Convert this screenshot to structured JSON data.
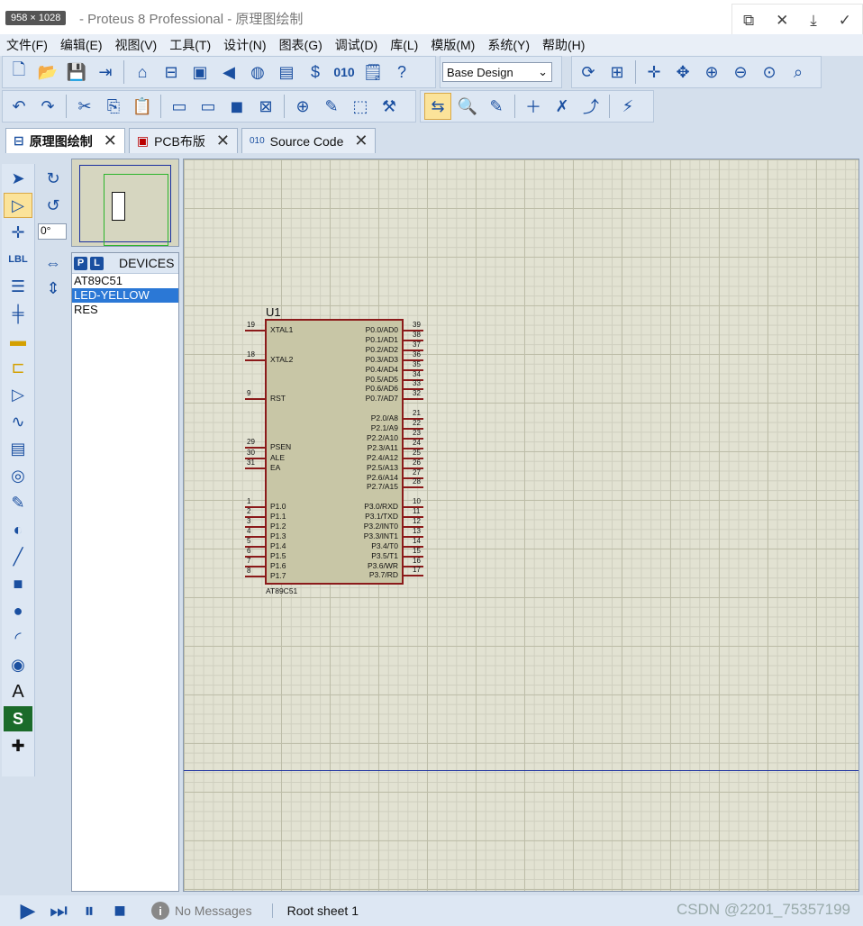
{
  "titlebar": {
    "size_badge": "958 × 1028",
    "title": "- Proteus 8 Professional - 原理图绘制"
  },
  "window_controls": [
    "open-external-icon",
    "close-icon",
    "download-icon",
    "check-icon"
  ],
  "menu": [
    "文件(F)",
    "编辑(E)",
    "视图(V)",
    "工具(T)",
    "设计(N)",
    "图表(G)",
    "调试(D)",
    "库(L)",
    "模版(M)",
    "系统(Y)",
    "帮助(H)"
  ],
  "toolbar": {
    "design_select": "Base Design",
    "source_label": "010"
  },
  "tabs": [
    {
      "label": "原理图绘制",
      "active": true
    },
    {
      "label": "PCB布版",
      "active": false
    },
    {
      "label": "Source Code",
      "active": false
    }
  ],
  "left": {
    "angle": "0°",
    "devices_title": "DEVICES",
    "p_label": "P",
    "l_label": "L",
    "lbl_tool": "LBL",
    "text_tool": "A",
    "script_tool": "S",
    "devices": [
      "AT89C51",
      "LED-YELLOW",
      "RES"
    ],
    "selected_device": "LED-YELLOW"
  },
  "schematic": {
    "ref": "U1",
    "part": "AT89C51",
    "left_pins": [
      {
        "num": "19",
        "name": "XTAL1"
      },
      {
        "num": "18",
        "name": "XTAL2"
      },
      {
        "num": "9",
        "name": "RST"
      },
      {
        "num": "29",
        "name": "PSEN"
      },
      {
        "num": "30",
        "name": "ALE"
      },
      {
        "num": "31",
        "name": "EA"
      },
      {
        "num": "1",
        "name": "P1.0"
      },
      {
        "num": "2",
        "name": "P1.1"
      },
      {
        "num": "3",
        "name": "P1.2"
      },
      {
        "num": "4",
        "name": "P1.3"
      },
      {
        "num": "5",
        "name": "P1.4"
      },
      {
        "num": "6",
        "name": "P1.5"
      },
      {
        "num": "7",
        "name": "P1.6"
      },
      {
        "num": "8",
        "name": "P1.7"
      }
    ],
    "right_pins": [
      {
        "num": "39",
        "name": "P0.0/AD0"
      },
      {
        "num": "38",
        "name": "P0.1/AD1"
      },
      {
        "num": "37",
        "name": "P0.2/AD2"
      },
      {
        "num": "36",
        "name": "P0.3/AD3"
      },
      {
        "num": "35",
        "name": "P0.4/AD4"
      },
      {
        "num": "34",
        "name": "P0.5/AD5"
      },
      {
        "num": "33",
        "name": "P0.6/AD6"
      },
      {
        "num": "32",
        "name": "P0.7/AD7"
      },
      {
        "num": "21",
        "name": "P2.0/A8"
      },
      {
        "num": "22",
        "name": "P2.1/A9"
      },
      {
        "num": "23",
        "name": "P2.2/A10"
      },
      {
        "num": "24",
        "name": "P2.3/A11"
      },
      {
        "num": "25",
        "name": "P2.4/A12"
      },
      {
        "num": "26",
        "name": "P2.5/A13"
      },
      {
        "num": "27",
        "name": "P2.6/A14"
      },
      {
        "num": "28",
        "name": "P2.7/A15"
      },
      {
        "num": "10",
        "name": "P3.0/RXD"
      },
      {
        "num": "11",
        "name": "P3.1/TXD"
      },
      {
        "num": "12",
        "name": "P3.2/INT0"
      },
      {
        "num": "13",
        "name": "P3.3/INT1"
      },
      {
        "num": "14",
        "name": "P3.4/T0"
      },
      {
        "num": "15",
        "name": "P3.5/T1"
      },
      {
        "num": "16",
        "name": "P3.6/WR"
      },
      {
        "num": "17",
        "name": "P3.7/RD"
      }
    ]
  },
  "status": {
    "messages": "No Messages",
    "sheet": "Root sheet 1",
    "info_glyph": "i"
  },
  "watermark": "CSDN @2201_75357199"
}
